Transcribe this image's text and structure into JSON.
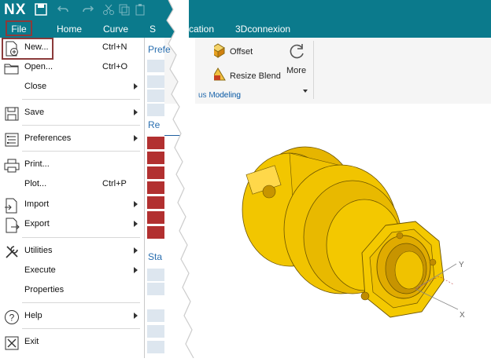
{
  "app": {
    "logo": "NX"
  },
  "ribbon": {
    "tabs": [
      "File",
      "Home",
      "Curve",
      "S",
      "cation",
      "3Dconnexion"
    ],
    "offset_label": "Offset",
    "resize_blend_label": "Resize Blend",
    "more_label": "More",
    "group_label": "us Modeling"
  },
  "file_menu": {
    "items": [
      {
        "label": "New...",
        "shortcut": "Ctrl+N",
        "icon": "new-file-icon"
      },
      {
        "label": "Open...",
        "shortcut": "Ctrl+O",
        "icon": "open-folder-icon"
      },
      {
        "label": "Close",
        "submenu": true
      },
      {
        "label": "Save",
        "submenu": true,
        "icon": "save-icon"
      },
      {
        "label": "Preferences",
        "submenu": true,
        "icon": "preferences-icon"
      },
      {
        "label": "Print...",
        "icon": "printer-icon"
      },
      {
        "label": "Plot...",
        "shortcut": "Ctrl+P"
      },
      {
        "label": "Import",
        "submenu": true,
        "icon": "import-icon"
      },
      {
        "label": "Export",
        "submenu": true,
        "icon": "export-icon"
      },
      {
        "label": "Utilities",
        "submenu": true,
        "icon": "utilities-icon"
      },
      {
        "label": "Execute",
        "submenu": true
      },
      {
        "label": "Properties"
      },
      {
        "label": "Help",
        "submenu": true,
        "icon": "help-icon"
      },
      {
        "label": "Exit",
        "icon": "exit-icon"
      }
    ]
  },
  "mid_panel": {
    "head1": "Prefe",
    "head2": "Re",
    "head3": "Sta"
  },
  "colors": {
    "accent": "#0b7a8c",
    "highlight": "#8b3a3a",
    "part": "#f2c200"
  }
}
